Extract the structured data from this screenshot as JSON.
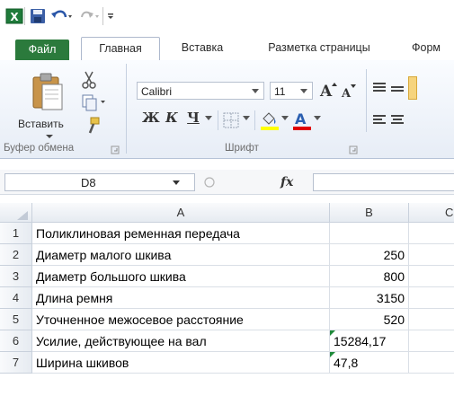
{
  "tabs": [
    "Файл",
    "Главная",
    "Вставка",
    "Разметка страницы",
    "Форм"
  ],
  "ribbon": {
    "paste_label": "Вставить",
    "clipboard_group": "Буфер обмена",
    "font_group": "Шрифт",
    "font_name": "Calibri",
    "font_size": "11",
    "bold": "Ж",
    "italic": "К",
    "underline": "Ч"
  },
  "formula_bar": {
    "name_box": "D8",
    "fx": "fx",
    "value": ""
  },
  "sheet": {
    "columns": [
      "A",
      "B",
      "C"
    ],
    "rows": [
      {
        "num": "1",
        "a": "Поликлиновая ременная передача",
        "b": ""
      },
      {
        "num": "2",
        "a": "Диаметр малого шкива",
        "b": "250"
      },
      {
        "num": "3",
        "a": "Диаметр большого шкива",
        "b": "800"
      },
      {
        "num": "4",
        "a": "Длина ремня",
        "b": "3150"
      },
      {
        "num": "5",
        "a": "Уточненное межосевое расстояние",
        "b": "520"
      },
      {
        "num": "6",
        "a": "Усилие, действующее на вал",
        "b": "15284,17"
      },
      {
        "num": "7",
        "a": "Ширина шкивов",
        "b": "47,8"
      }
    ]
  },
  "colors": {
    "file_tab": "#2b7a3c",
    "error_triangle": "#1f8a3a"
  }
}
